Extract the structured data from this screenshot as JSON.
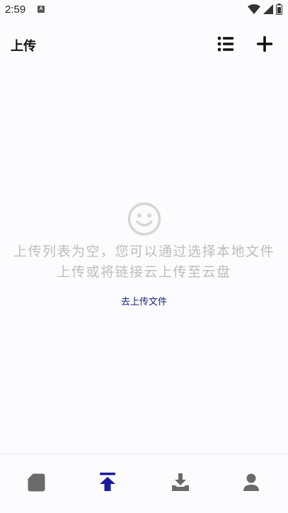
{
  "status_bar": {
    "time": "2:59",
    "notification_letter": "A",
    "icons": [
      "wifi-icon",
      "signal-icon",
      "battery-icon"
    ]
  },
  "header": {
    "title": "上传",
    "actions": [
      "list-icon",
      "plus-icon"
    ]
  },
  "empty_state": {
    "icon": "smile-icon",
    "message": "上传列表为空，您可以通过选择本地文件上传或将链接云上传至云盘",
    "action_label": "去上传文件"
  },
  "bottom_nav": {
    "items": [
      {
        "icon": "file-icon",
        "active": false
      },
      {
        "icon": "upload-icon",
        "active": true
      },
      {
        "icon": "download-icon",
        "active": false
      },
      {
        "icon": "person-icon",
        "active": false
      }
    ],
    "active_color": "#1a1aa0",
    "inactive_color": "#6b6b6b"
  },
  "colors": {
    "background": "#fcfbfd",
    "empty_text": "#bdbdbd",
    "link": "#1a237e"
  }
}
